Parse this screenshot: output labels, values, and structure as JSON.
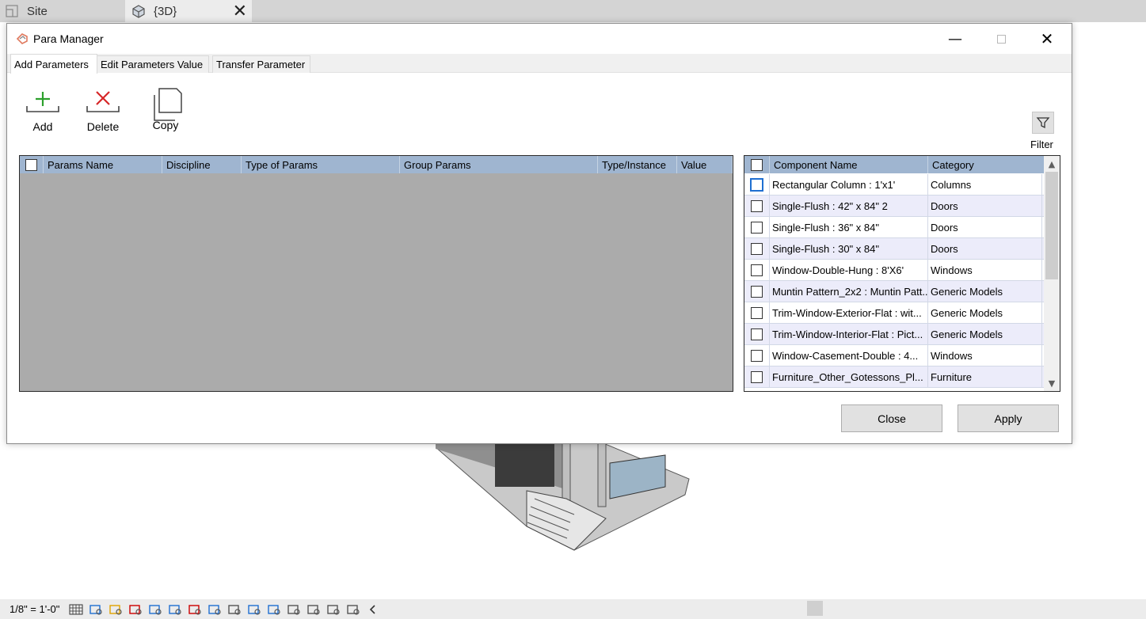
{
  "view_tabs": [
    {
      "label": "Site",
      "icon": "site-view-icon"
    },
    {
      "label": "{3D}",
      "icon": "3d-view-icon"
    }
  ],
  "dialog": {
    "title": "Para Manager",
    "tabs": [
      "Add Parameters",
      "Edit Parameters Value",
      "Transfer Parameter"
    ],
    "active_tab": "Add Parameters",
    "toolbar": {
      "add_label": "Add",
      "delete_label": "Delete",
      "copy_label": "Copy",
      "filter_label": "Filter"
    },
    "params_grid": {
      "columns": [
        "Params Name",
        "Discipline",
        "Type of Params",
        "Group Params",
        "Type/Instance",
        "Value"
      ],
      "rows": []
    },
    "component_grid": {
      "columns": [
        "Component Name",
        "Category"
      ],
      "rows": [
        {
          "name": "Rectangular Column : 1'x1'",
          "category": "Columns"
        },
        {
          "name": "Single-Flush : 42\" x 84\" 2",
          "category": "Doors"
        },
        {
          "name": "Single-Flush : 36\" x 84\"",
          "category": "Doors"
        },
        {
          "name": "Single-Flush : 30\" x 84\"",
          "category": "Doors"
        },
        {
          "name": "Window-Double-Hung : 8'X6'",
          "category": "Windows"
        },
        {
          "name": "Muntin Pattern_2x2 : Muntin Patt...",
          "category": "Generic Models"
        },
        {
          "name": "Trim-Window-Exterior-Flat : wit...",
          "category": "Generic Models"
        },
        {
          "name": "Trim-Window-Interior-Flat : Pict...",
          "category": "Generic Models"
        },
        {
          "name": "Window-Casement-Double : 4...",
          "category": "Windows"
        },
        {
          "name": "Furniture_Other_Gotessons_Pl...",
          "category": "Furniture"
        }
      ]
    },
    "buttons": {
      "close": "Close",
      "apply": "Apply"
    }
  },
  "status_bar": {
    "scale": "1/8\" = 1'-0\"",
    "icons": [
      "detail-level-icon",
      "visual-style-icon",
      "sun-path-icon",
      "shadows-icon",
      "render-icon",
      "crop-view-icon",
      "show-crop-icon",
      "unlock-3d-icon",
      "temporary-hide-icon",
      "reveal-hidden-icon",
      "analytical-icon",
      "highlight-displacement-icon",
      "worksharing-icon",
      "design-options-icon",
      "constraints-icon",
      "collapse-arrow-icon"
    ]
  }
}
